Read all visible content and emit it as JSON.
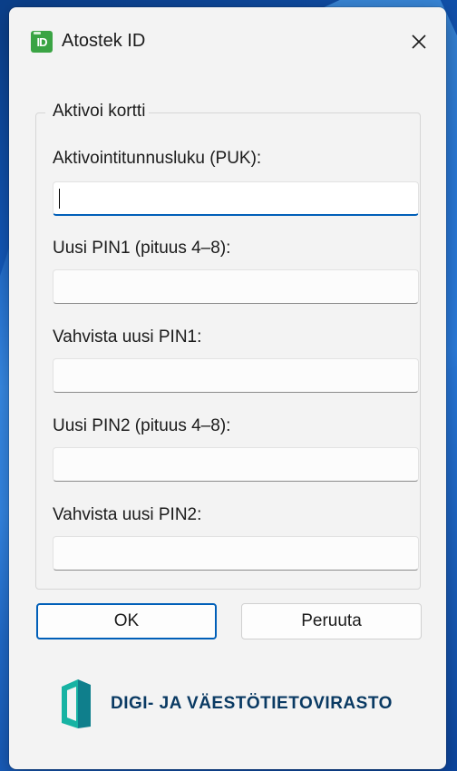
{
  "window": {
    "title": "Atostek ID",
    "app_icon_text": "ID"
  },
  "group": {
    "title": "Aktivoi kortti"
  },
  "fields": [
    {
      "label": "Aktivointitunnusluku (PUK):",
      "value": ""
    },
    {
      "label": "Uusi PIN1 (pituus 4–8):",
      "value": ""
    },
    {
      "label": "Vahvista uusi PIN1:",
      "value": ""
    },
    {
      "label": "Uusi PIN2 (pituus 4–8):",
      "value": ""
    },
    {
      "label": "Vahvista uusi PIN2:",
      "value": ""
    }
  ],
  "buttons": {
    "ok": "OK",
    "cancel": "Peruuta"
  },
  "brand": {
    "name": "DIGI- JA VÄESTÖTIETOVIRASTO",
    "logo_icon": "dvv-logo-icon"
  },
  "colors": {
    "accent": "#005fb8",
    "app_icon": "#3aa444",
    "brand_text": "#0a3a63",
    "brand_logo": "#1aa39a"
  }
}
